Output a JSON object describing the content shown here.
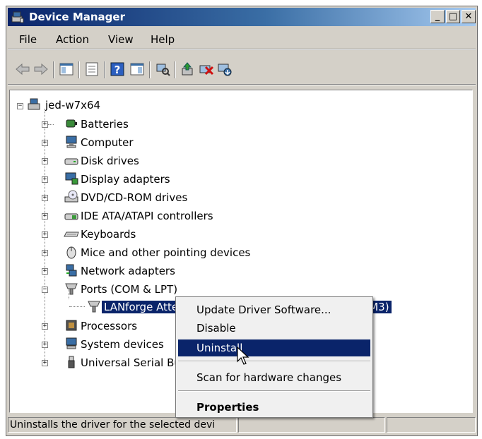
{
  "window": {
    "title": "Device Manager",
    "controls": {
      "minimize": "_",
      "maximize": "□",
      "close": "✕"
    }
  },
  "menubar": {
    "items": [
      "File",
      "Action",
      "View",
      "Help"
    ]
  },
  "toolbar": {
    "icons": [
      "back-arrow-icon",
      "forward-arrow-icon",
      "show-hide-console-tree-icon",
      "properties-icon",
      "help-icon",
      "show-action-pane-icon",
      "scan-hardware-icon",
      "update-driver-icon",
      "uninstall-icon",
      "enable-device-icon"
    ]
  },
  "tree": {
    "root": "jed-w7x64",
    "categories": [
      {
        "label": "Batteries",
        "icon": "battery-icon"
      },
      {
        "label": "Computer",
        "icon": "computer-icon"
      },
      {
        "label": "Disk drives",
        "icon": "disk-drive-icon"
      },
      {
        "label": "Display adapters",
        "icon": "display-adapter-icon"
      },
      {
        "label": "DVD/CD-ROM drives",
        "icon": "dvd-drive-icon"
      },
      {
        "label": "IDE ATA/ATAPI controllers",
        "icon": "ide-controller-icon"
      },
      {
        "label": "Keyboards",
        "icon": "keyboard-icon"
      },
      {
        "label": "Mice and other pointing devices",
        "icon": "mouse-icon"
      },
      {
        "label": "Network adapters",
        "icon": "network-adapter-icon"
      },
      {
        "label": "Ports (COM & LPT)",
        "icon": "port-icon"
      },
      {
        "label": "Processors",
        "icon": "processor-icon"
      },
      {
        "label": "System devices",
        "icon": "system-devices-icon"
      },
      {
        "label": "Universal Serial Bu",
        "icon": "usb-icon"
      }
    ],
    "selected_child": "LANforge Attenuator (Arduino Mega 2560 R3) (COM3)"
  },
  "context_menu": {
    "items": [
      "Update Driver Software...",
      "Disable",
      "Uninstall",
      "Scan for hardware changes",
      "Properties"
    ],
    "highlighted": "Uninstall"
  },
  "statusbar": {
    "text": "Uninstalls the driver for the selected devi"
  },
  "colors": {
    "selection": "#0a246a",
    "title_start": "#0a246a",
    "title_end": "#a6caf0",
    "face": "#d4d0c8"
  }
}
